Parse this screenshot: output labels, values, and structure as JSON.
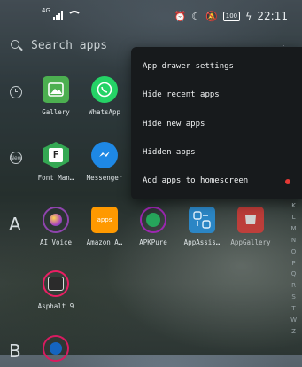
{
  "status_bar": {
    "network": "4G",
    "battery": "100",
    "time": "22:11"
  },
  "search": {
    "placeholder": "Search apps"
  },
  "section_letters": {
    "a": "A",
    "b": "B"
  },
  "apps": [
    {
      "label": "Gallery"
    },
    {
      "label": "WhatsApp"
    },
    {
      "label": "Font Man…"
    },
    {
      "label": "Messenger"
    },
    {
      "label": "AI Voice"
    },
    {
      "label": "Amazon A…"
    },
    {
      "label": "APKPure"
    },
    {
      "label": "AppAssis…"
    },
    {
      "label": "AppGallery"
    },
    {
      "label": "Asphalt 9"
    }
  ],
  "icon_text": {
    "new_badge": "New",
    "amazon": "apps"
  },
  "menu": {
    "items": [
      {
        "label": "App drawer settings"
      },
      {
        "label": "Hide recent apps"
      },
      {
        "label": "Hide new apps"
      },
      {
        "label": "Hidden apps"
      },
      {
        "label": "Add apps to homescreen"
      }
    ],
    "notification_dot_color": "#e53935"
  },
  "alphabet_index": [
    "K",
    "L",
    "M",
    "N",
    "O",
    "P",
    "Q",
    "R",
    "S",
    "T",
    "W",
    "Z"
  ]
}
